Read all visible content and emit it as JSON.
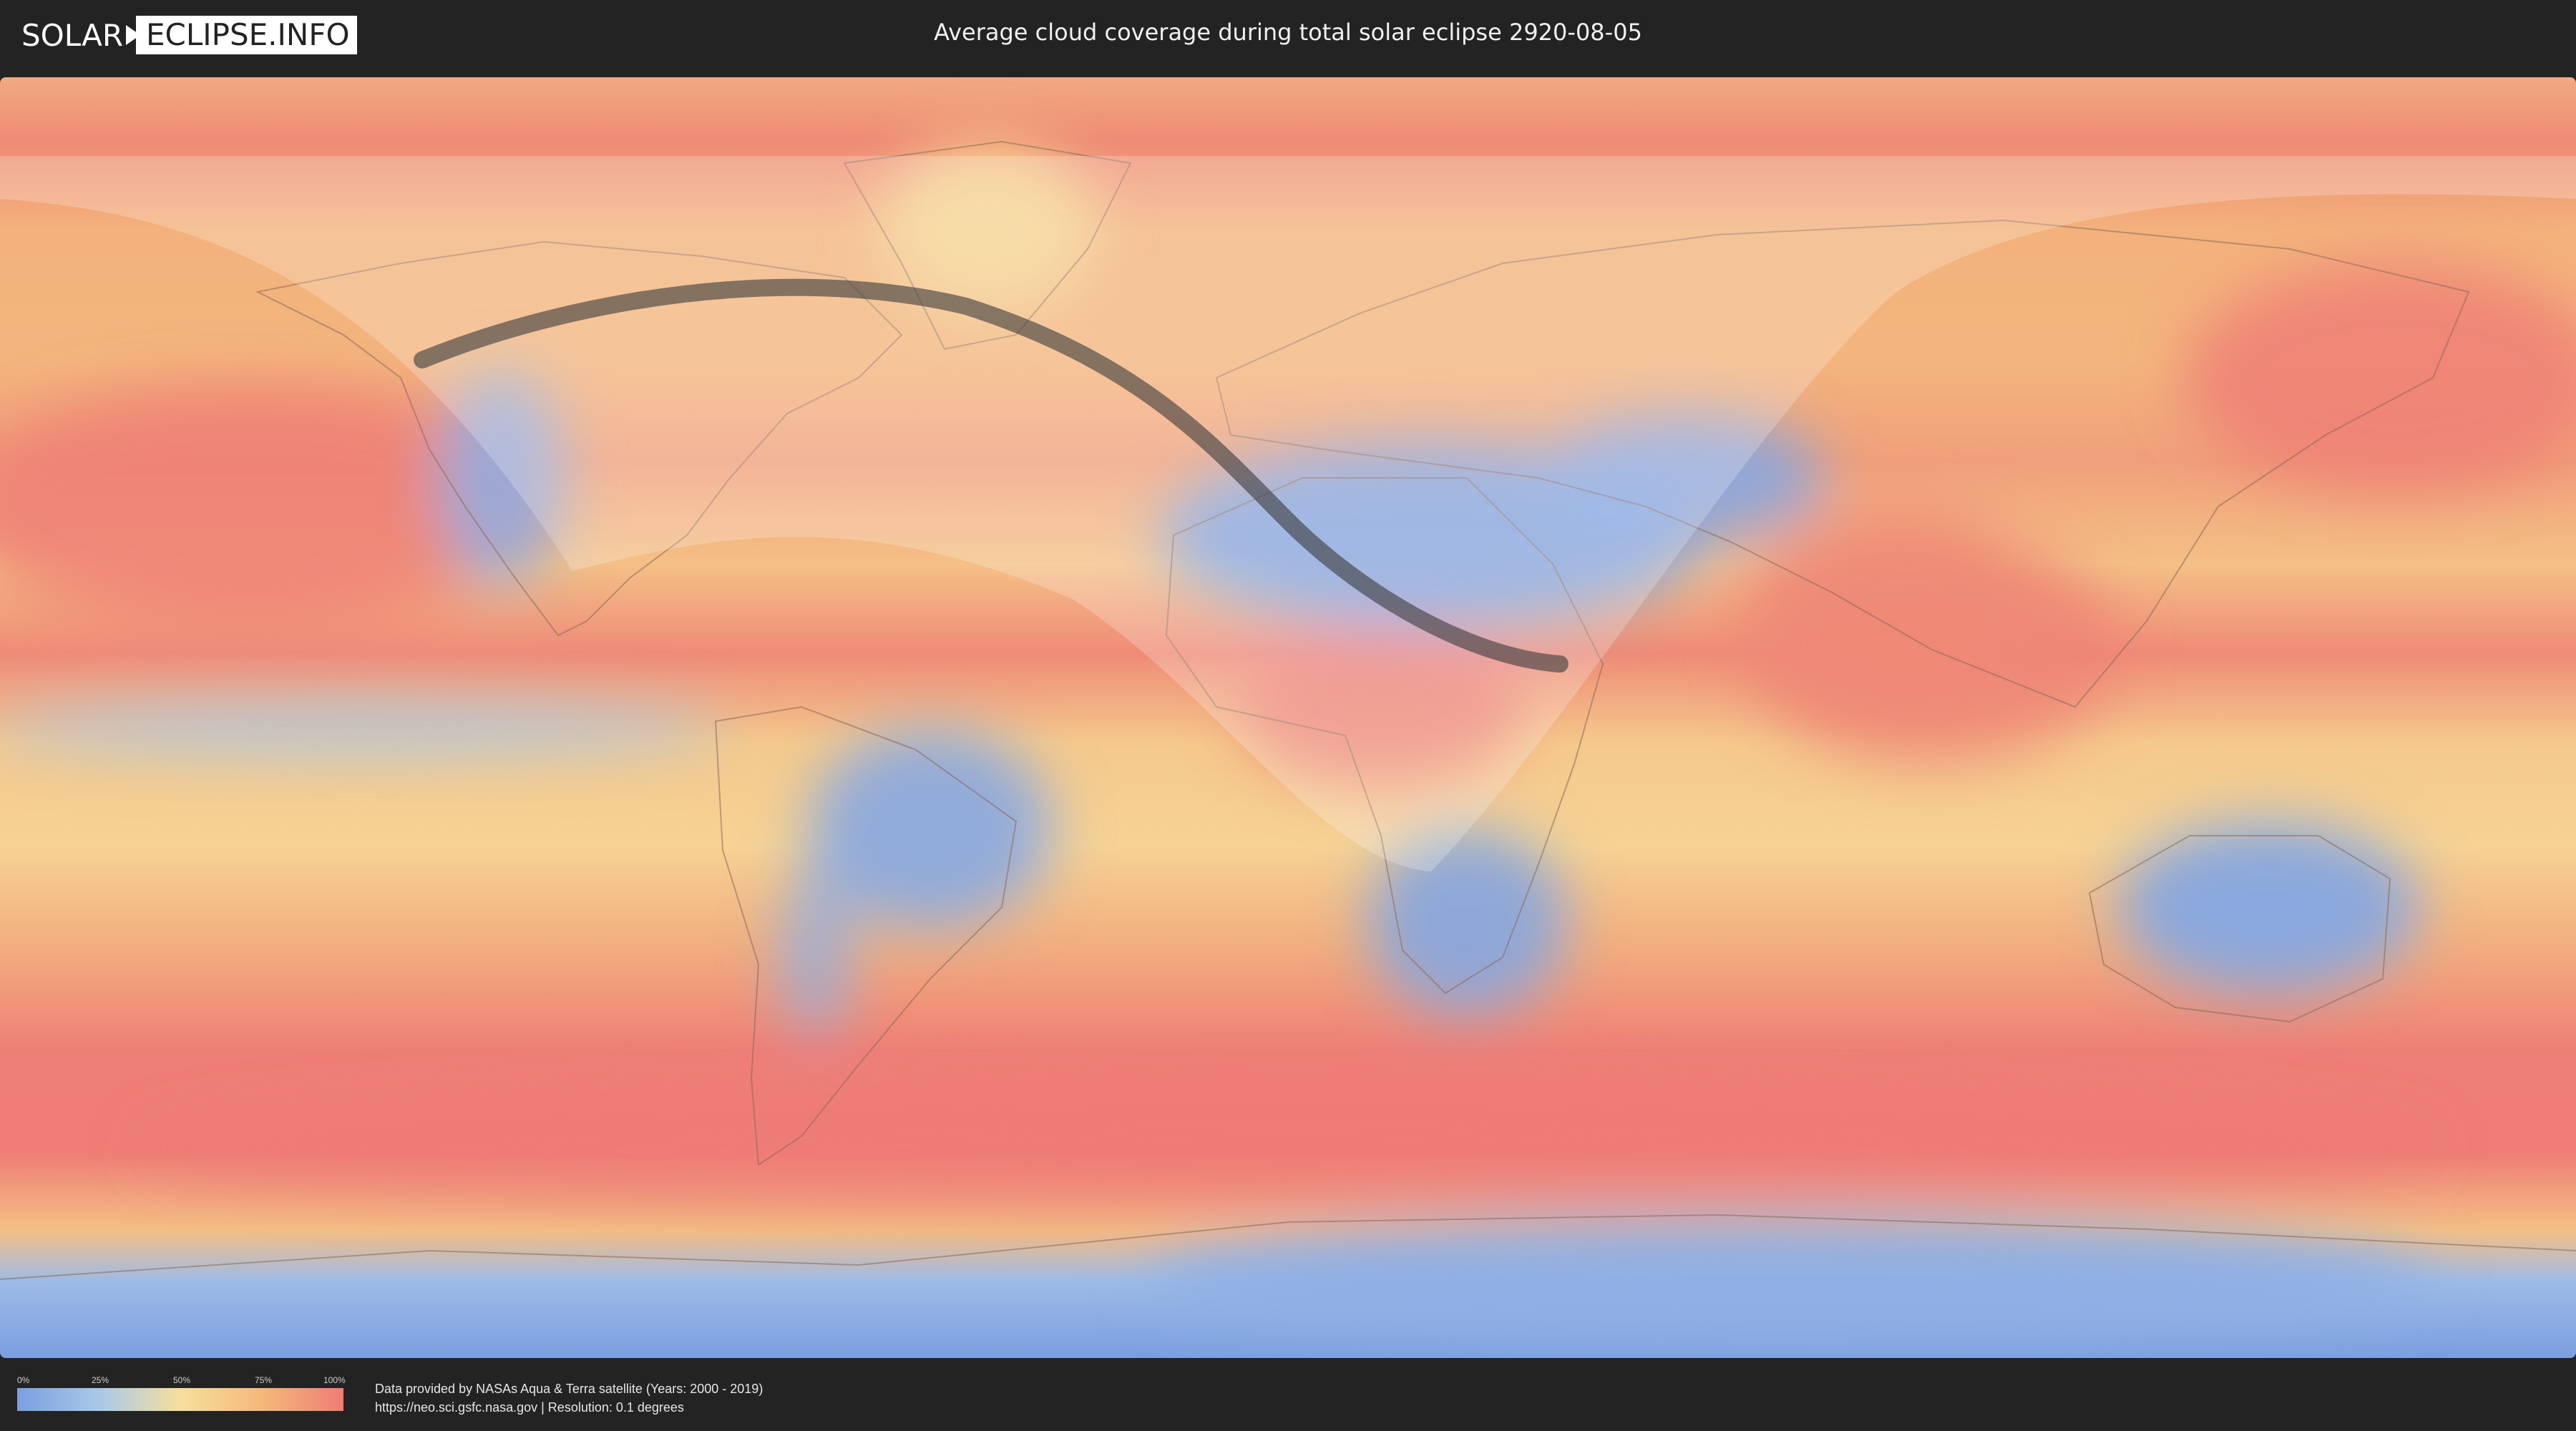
{
  "header": {
    "logo_solar": "SOLAR",
    "logo_eclipse": "ECLIPSE.INFO",
    "title": "Average cloud coverage during total solar eclipse 2920-08-05"
  },
  "map": {
    "type": "world cloud coverage map",
    "projection": "equirectangular",
    "colors": {
      "clear": "#7a9fe0",
      "low": "#a9c8e8",
      "mid": "#f6df9d",
      "high": "#f5b879",
      "overcast": "#ee7d76",
      "eclipse_path": "#3a3a3a"
    }
  },
  "legend": {
    "ticks": [
      "0%",
      "25%",
      "50%",
      "75%",
      "100%"
    ]
  },
  "footer": {
    "credit_line1": "Data provided by NASAs Aqua & Terra satellite (Years: 2000 - 2019)",
    "credit_line2": "https://neo.sci.gsfc.nasa.gov | Resolution: 0.1 degrees"
  }
}
